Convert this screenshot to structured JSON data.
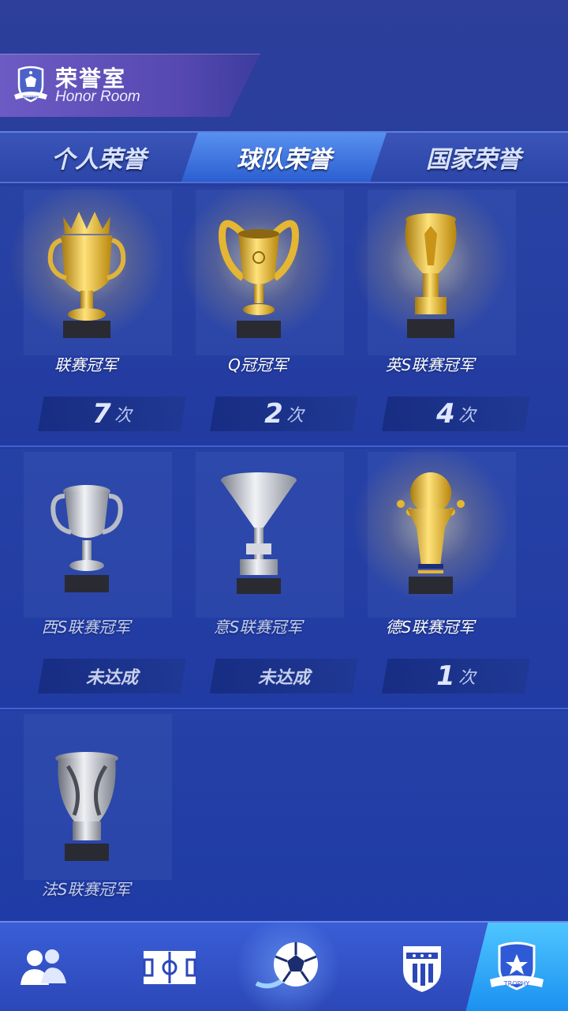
{
  "header": {
    "title": "荣誉室",
    "subtitle": "Honor Room",
    "logo_icon": "trophy-shield-icon",
    "logo_text": "TROPHY"
  },
  "tabs": [
    {
      "label": "个人荣誉",
      "active": false
    },
    {
      "label": "球队荣誉",
      "active": true
    },
    {
      "label": "国家荣誉",
      "active": false
    }
  ],
  "trophies": [
    {
      "name": "联赛冠军",
      "count": "7",
      "unit": "次",
      "status": "",
      "material": "gold"
    },
    {
      "name": "Q冠冠军",
      "count": "2",
      "unit": "次",
      "status": "",
      "material": "gold"
    },
    {
      "name": "英S联赛冠军",
      "count": "4",
      "unit": "次",
      "status": "",
      "material": "gold"
    },
    {
      "name": "西S联赛冠军",
      "count": "",
      "unit": "",
      "status": "未达成",
      "material": "silver"
    },
    {
      "name": "意S联赛冠军",
      "count": "",
      "unit": "",
      "status": "未达成",
      "material": "silver"
    },
    {
      "name": "德S联赛冠军",
      "count": "1",
      "unit": "次",
      "status": "",
      "material": "gold"
    },
    {
      "name": "法S联赛冠军",
      "count": "",
      "unit": "",
      "status": "",
      "material": "silver"
    }
  ],
  "nav": {
    "items": [
      {
        "icon": "players-icon",
        "active": false
      },
      {
        "icon": "pitch-icon",
        "active": false
      },
      {
        "icon": "soccer-ball-icon",
        "active": false
      },
      {
        "icon": "club-badge-icon",
        "active": false
      },
      {
        "icon": "trophy-badge-icon",
        "active": true,
        "text": "TROPHY"
      }
    ]
  },
  "colors": {
    "gold": "#f2c530",
    "silver": "#c9ccd4",
    "accent": "#2c8ff0"
  }
}
